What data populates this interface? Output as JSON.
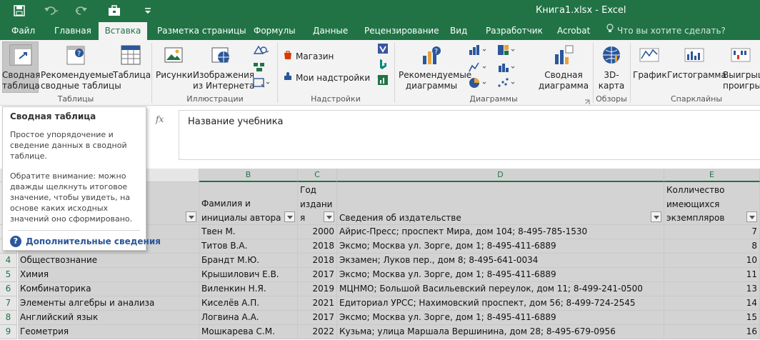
{
  "window": {
    "title": "Книга1.xlsx - Excel"
  },
  "colors": {
    "excel_green": "#217346",
    "ribbon_bg": "#f3f3f3",
    "selection_gray": "#d3d3d3"
  },
  "qat": {
    "icons": [
      "save-icon",
      "undo-icon",
      "redo-icon",
      "briefcase-icon",
      "customize-qat-icon"
    ]
  },
  "tabs": [
    {
      "label": "Файл"
    },
    {
      "label": "Главная"
    },
    {
      "label": "Вставка"
    },
    {
      "label": "Разметка страницы"
    },
    {
      "label": "Формулы"
    },
    {
      "label": "Данные"
    },
    {
      "label": "Рецензирование"
    },
    {
      "label": "Вид"
    },
    {
      "label": "Разработчик"
    },
    {
      "label": "Acrobat"
    }
  ],
  "tellme": {
    "label": "Что вы хотите сделать?"
  },
  "ribbon": {
    "pivot": {
      "line1": "Сводная",
      "line2": "таблица"
    },
    "recommended_pivots": {
      "line1": "Рекомендуемые",
      "line2": "сводные таблицы"
    },
    "table": {
      "label": "Таблица"
    },
    "group_tables": "Таблицы",
    "pictures": {
      "label": "Рисунки"
    },
    "online_pictures": {
      "line1": "Изображения",
      "line2": "из Интернета"
    },
    "group_illustrations": "Иллюстрации",
    "store": {
      "label": "Магазин"
    },
    "my_addins": {
      "label": "Мои надстройки"
    },
    "group_addins": "Надстройки",
    "recommended_charts": {
      "line1": "Рекомендуемые",
      "line2": "диаграммы"
    },
    "pivot_chart": {
      "line1": "Сводная",
      "line2": "диаграмма"
    },
    "group_charts": "Диаграммы",
    "map3d": {
      "line1": "3D-",
      "line2": "карта"
    },
    "group_tours": "Обзоры",
    "sparkline_line": {
      "label": "График"
    },
    "sparkline_column": {
      "label": "Гистограмма"
    },
    "sparkline_winloss": {
      "line1": "Выигрыш",
      "line2": "проигрыш"
    },
    "group_sparklines": "Спарклайны"
  },
  "formula_bar": {
    "fx": "fx",
    "content": "Название учебника"
  },
  "tooltip": {
    "title": "Сводная таблица",
    "p1": "Простое упорядочение и сведение данных в сводной таблице.",
    "p2": "Обратите внимание: можно дважды щелкнуть итоговое значение, чтобы увидеть, на основе каких исходных значений оно сформировано.",
    "help_glyph": "?",
    "more": "Дополнительные сведения"
  },
  "sheet": {
    "columns": [
      "B",
      "C",
      "D",
      "E"
    ],
    "headers": {
      "b": [
        "Фамилия и",
        "инициалы автора"
      ],
      "c": [
        "Год",
        "издани",
        "я"
      ],
      "d": [
        "Сведения об издательстве"
      ],
      "e": [
        "Колличество",
        "имеющихся",
        "экземпляров"
      ]
    },
    "rows": [
      {
        "num": "",
        "a": "",
        "b": "Твен М.",
        "c": "2000",
        "d": "Айрис-Пресс; проспект Мира, дом 104; 8-495-785-1530",
        "e": "7"
      },
      {
        "num": "",
        "a": "",
        "b": "Титов В.А.",
        "c": "2018",
        "d": "Эксмо; Москва ул. Зорге, дом 1; 8-495-411-6889",
        "e": "8"
      },
      {
        "num": "4",
        "a": "Обществознание",
        "b": "Брандт М.Ю.",
        "c": "2018",
        "d": "Экзамен; Луков пер., дом 8; 8-495-641-0034",
        "e": "10"
      },
      {
        "num": "5",
        "a": "Химия",
        "b": "Крышилович Е.В.",
        "c": "2017",
        "d": "Эксмо; Москва ул. Зорге, дом 1; 8-495-411-6889",
        "e": "11"
      },
      {
        "num": "6",
        "a": "Комбинаторика",
        "b": "Виленкин Н.Я.",
        "c": "2019",
        "d": "МЦНМО; Большой Васильевский переулок, дом 11; 8-499-241-0500",
        "e": "13"
      },
      {
        "num": "7",
        "a": "Элементы алгебры и анализа",
        "b": "Киселёв А.П.",
        "c": "2021",
        "d": "Едиториал УРСС; Нахимовский проспект, дом 56; 8-499-724-2545",
        "e": "14"
      },
      {
        "num": "8",
        "a": "Английский язык",
        "b": "Логвина А.А.",
        "c": "2017",
        "d": "Эксмо; Москва ул. Зорге, дом 1; 8-495-411-6889",
        "e": "15"
      },
      {
        "num": "9",
        "a": "Геометрия",
        "b": "Мошкарева С.М.",
        "c": "2022",
        "d": "Кузьма; улица Маршала Вершинина, дом 28; 8-495-679-0956",
        "e": "16"
      }
    ]
  }
}
